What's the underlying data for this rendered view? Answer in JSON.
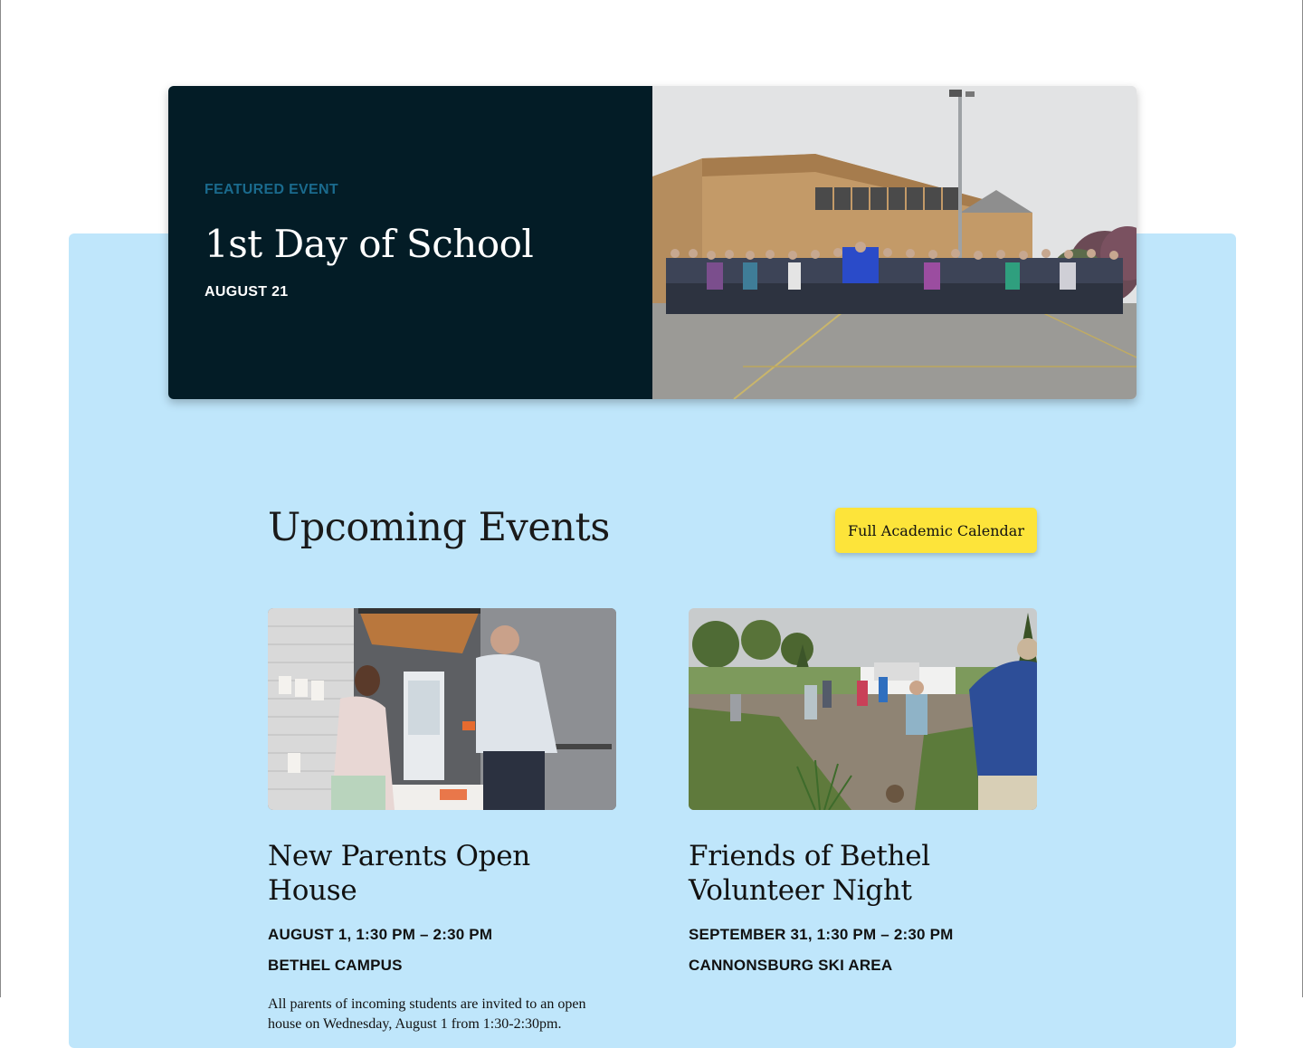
{
  "featured": {
    "label": "FEATURED EVENT",
    "title": "1st Day of School",
    "date": "AUGUST 21",
    "colors": {
      "panel": "#031c26",
      "label": "#1a6a8d"
    }
  },
  "upcoming": {
    "heading": "Upcoming Events",
    "calendar_button": "Full Academic Calendar",
    "section_color": "#bfe6fb",
    "button_color": "#fde43a"
  },
  "events": [
    {
      "title": "New Parents Open House",
      "datetime": "AUGUST 1, 1:30 PM – 2:30 PM",
      "location": "BETHEL CAMPUS",
      "description": "All parents of incoming students are invited to an open house on Wednesday, August 1 from 1:30-2:30pm."
    },
    {
      "title": "Friends of Bethel Volunteer Night",
      "datetime": "SEPTEMBER 31, 1:30 PM – 2:30 PM",
      "location": "CANNONSBURG SKI AREA"
    }
  ]
}
